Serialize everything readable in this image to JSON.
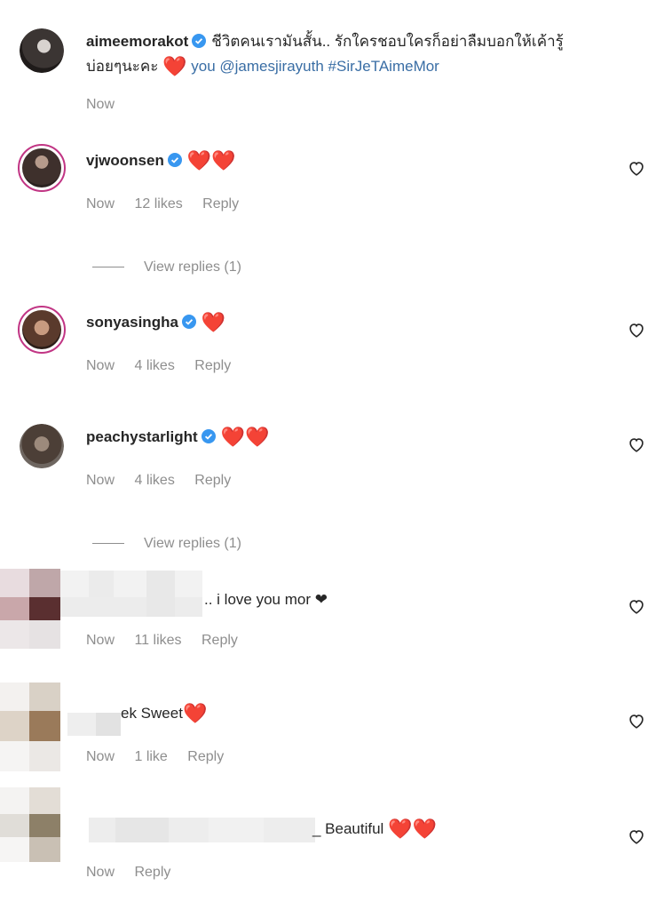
{
  "caption": {
    "username": "aimeemorakot",
    "text_line1": "ชีวิตคนเรามันสั้น.. รักใครชอบใครก็อย่าลืมบอกให้เค้ารู้",
    "text_line2_prefix": "บ่อยๆนะคะ",
    "text_line2_heart": "❤️",
    "text_line2_you": "you",
    "mention": "@jamesjirayuth",
    "hashtag": "#SirJeTAimeMor",
    "time": "Now"
  },
  "comments": [
    {
      "username": "vjwoonsen",
      "text": "❤️❤️",
      "time": "Now",
      "likes": "12 likes",
      "reply": "Reply"
    },
    {
      "username": "sonyasingha",
      "text": "❤️",
      "time": "Now",
      "likes": "4 likes",
      "reply": "Reply"
    },
    {
      "username": "peachystarlight",
      "text": "❤️❤️",
      "time": "Now",
      "likes": "4 likes",
      "reply": "Reply"
    },
    {
      "text": ".. i love you mor ❤",
      "time": "Now",
      "likes": "11 likes",
      "reply": "Reply"
    },
    {
      "text": "ek Sweet",
      "heart": "❤️",
      "time": "Now",
      "likes": "1 like",
      "reply": "Reply"
    },
    {
      "text": "_ Beautiful",
      "hearts": "❤️❤️",
      "time": "Now",
      "reply": "Reply"
    }
  ],
  "view_replies": [
    "View replies (1)",
    "View replies (1)"
  ],
  "icons": {
    "verified": "verified-badge-icon",
    "heart": "heart-outline-icon"
  },
  "colors": {
    "verified_blue": "#3897f0",
    "heart_red": "#d21f2c",
    "link": "#3a6ea5",
    "meta_gray": "#8e8e8e",
    "story_ring": "#c13584"
  }
}
